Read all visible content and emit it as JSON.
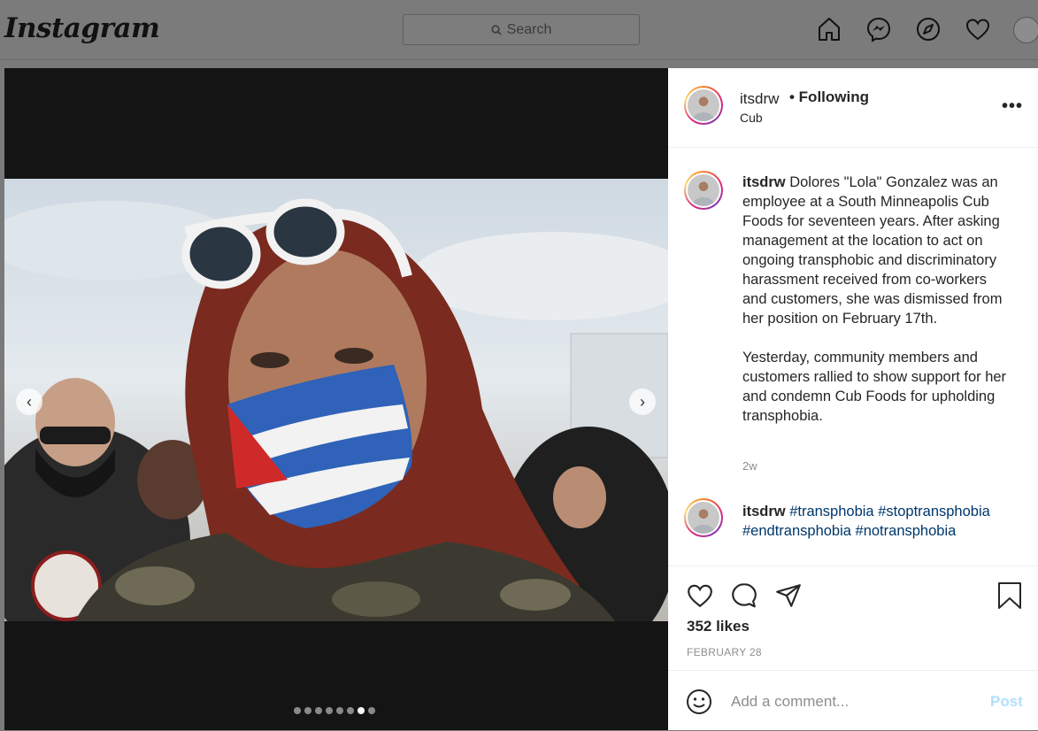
{
  "nav": {
    "logo": "Instagram",
    "search_placeholder": "Search"
  },
  "post": {
    "username": "itsdrw",
    "follow_status": "• Following",
    "location": "Cub",
    "caption": "Dolores \"Lola\" Gonzalez was an employee at a South Minneapolis Cub Foods for seventeen years. After asking management at the location to act on ongoing transphobic and discriminatory harassment received from co-workers and customers, she was dismissed from her position on February 17th.",
    "caption_2": "Yesterday, community members and customers rallied to show support for her and condemn Cub Foods for upholding transphobia.",
    "caption_time": "2w",
    "comment_user": "itsdrw",
    "hashtags": [
      "#transphobia",
      "#stoptransphobia",
      "#endtransphobia",
      "#notransphobia"
    ],
    "likes": "352 likes",
    "date": "FEBRUARY 28",
    "comment_placeholder": "Add a comment...",
    "post_button": "Post"
  },
  "carousel": {
    "total_slides": 8,
    "active_index": 6,
    "prev": "‹",
    "next": "›"
  },
  "colors": {
    "link": "#00376b",
    "post_button": "#b2dffc",
    "overlay": "#7a7a7a"
  }
}
